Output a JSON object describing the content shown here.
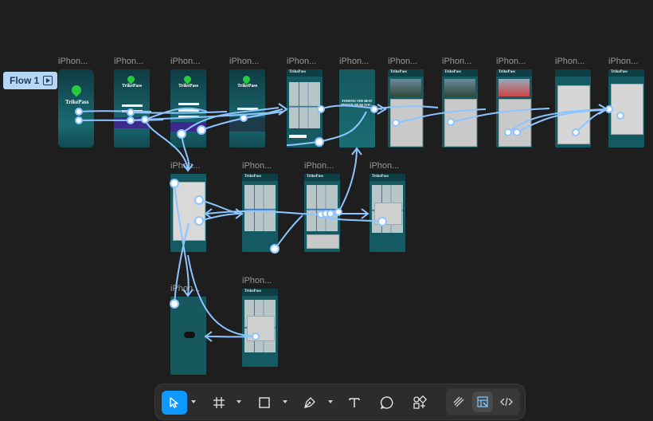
{
  "flow": {
    "label": "Flow 1",
    "icon": "play-frame-icon"
  },
  "frames": {
    "label": "iPhon...",
    "brand": "TrikePass",
    "finding_text": "FINDING THE BEST DRIVER NEAR YOU..."
  },
  "toolbar": {
    "tools": [
      "move-tool",
      "frame-tool",
      "rectangle-tool",
      "pen-tool",
      "text-tool",
      "comment-tool",
      "actions-tool"
    ],
    "modes": [
      "draw-mode",
      "design-mode",
      "dev-mode"
    ],
    "active_tool": "move-tool",
    "active_mode": "design-mode",
    "accent": "#0d99ff"
  },
  "colors": {
    "wire": "#8ec5ff",
    "canvas": "#1e1e1e",
    "frame": "#155a63"
  }
}
